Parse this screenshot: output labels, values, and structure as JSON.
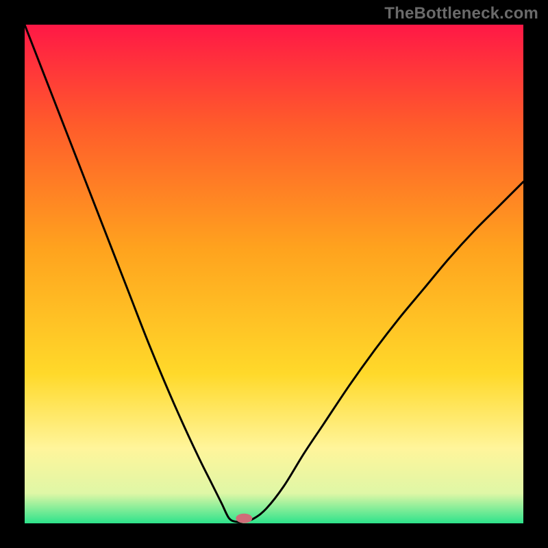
{
  "watermark": "TheBottleneck.com",
  "chart_data": {
    "type": "line",
    "title": "",
    "xlabel": "",
    "ylabel": "",
    "xlim": [
      0,
      1
    ],
    "ylim": [
      0,
      1
    ],
    "grid": false,
    "series": [
      {
        "name": "bottleneck-curve",
        "x": [
          0.0,
          0.035,
          0.07,
          0.105,
          0.14,
          0.175,
          0.21,
          0.245,
          0.28,
          0.315,
          0.35,
          0.375,
          0.395,
          0.41,
          0.425,
          0.44,
          0.46,
          0.485,
          0.52,
          0.56,
          0.6,
          0.65,
          0.7,
          0.75,
          0.8,
          0.85,
          0.9,
          0.95,
          1.0
        ],
        "y": [
          1.0,
          0.91,
          0.82,
          0.73,
          0.64,
          0.55,
          0.46,
          0.37,
          0.285,
          0.205,
          0.13,
          0.08,
          0.04,
          0.01,
          0.003,
          0.003,
          0.01,
          0.03,
          0.075,
          0.14,
          0.2,
          0.275,
          0.345,
          0.41,
          0.47,
          0.53,
          0.585,
          0.635,
          0.685
        ]
      }
    ],
    "marker": {
      "x": 0.44,
      "y": 0.01,
      "color": "#cf6c78",
      "rx": 12,
      "ry": 7
    },
    "background_gradient": {
      "direction": "vertical",
      "stops": [
        {
          "offset": 0.0,
          "color": "#ff1846"
        },
        {
          "offset": 0.2,
          "color": "#ff5b2b"
        },
        {
          "offset": 0.45,
          "color": "#ffa31e"
        },
        {
          "offset": 0.7,
          "color": "#ffd92a"
        },
        {
          "offset": 0.85,
          "color": "#fff59b"
        },
        {
          "offset": 0.94,
          "color": "#dff7a6"
        },
        {
          "offset": 1.0,
          "color": "#2de38b"
        }
      ]
    }
  }
}
